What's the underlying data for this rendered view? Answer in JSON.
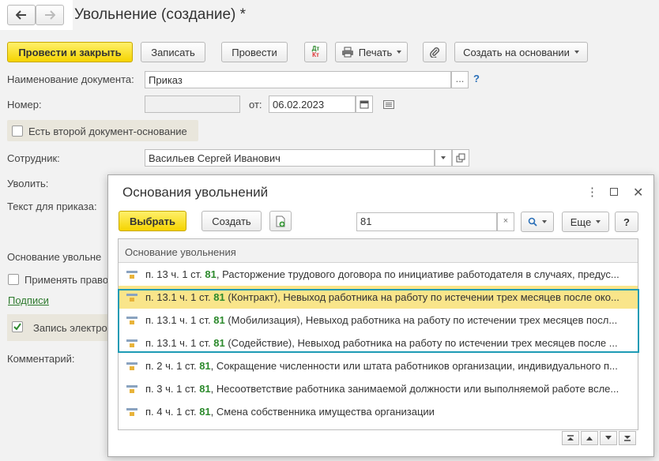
{
  "window": {
    "title": "Увольнение (создание) *"
  },
  "toolbar": {
    "post_close": "Провести и закрыть",
    "save": "Записать",
    "post": "Провести",
    "dtkt_top": "Дт",
    "dtkt_bottom": "Кт",
    "print": "Печать",
    "create_based": "Создать на основании"
  },
  "form": {
    "doc_name_label": "Наименование документа:",
    "doc_name_value": "Приказ",
    "number_label": "Номер:",
    "number_value": "",
    "date_from_label": "от:",
    "date_value": "06.02.2023",
    "second_doc_label": "Есть второй документ-основание",
    "employee_label": "Сотрудник:",
    "employee_value": "Васильев Сергей Иванович",
    "dismiss_label": "Уволить:",
    "order_text_label": "Текст для приказа:",
    "basis_label": "Основание увольне",
    "apply_label": "Применять право",
    "signatures_link": "Подписи",
    "electronic_label": "Запись электро",
    "comment_label": "Комментарий:"
  },
  "dialog": {
    "title": "Основания увольнений",
    "select_button": "Выбрать",
    "create_button": "Создать",
    "search_value": "81",
    "more_button": "Еще",
    "help_button": "?",
    "column_header": "Основание увольнения",
    "rows": [
      {
        "pre": "п. 13 ч. 1 ст. ",
        "num": "81",
        "post": ", Расторжение трудового договора по инициативе работодателя в случаях, предус..."
      },
      {
        "pre": "п. 13.1 ч. 1 ст. ",
        "num": "81",
        "post": " (Контракт), Невыход работника на работу по истечении трех месяцев после око..."
      },
      {
        "pre": "п. 13.1 ч. 1 ст. ",
        "num": "81",
        "post": " (Мобилизация), Невыход работника на работу по истечении трех месяцев посл..."
      },
      {
        "pre": "п. 13.1 ч. 1 ст. ",
        "num": "81",
        "post": " (Содействие), Невыход работника на работу по истечении трех месяцев после ..."
      },
      {
        "pre": "п. 2 ч. 1 ст. ",
        "num": "81",
        "post": ", Сокращение численности или штата работников организации, индивидуального п..."
      },
      {
        "pre": "п. 3 ч. 1 ст. ",
        "num": "81",
        "post": ", Несоответствие работника занимаемой должности или выполняемой работе всле..."
      },
      {
        "pre": "п. 4 ч. 1 ст. ",
        "num": "81",
        "post": ", Смена собственника имущества организации"
      }
    ]
  },
  "colors": {
    "accent_yellow": "#f5d400",
    "selected_row": "#f9e58a",
    "highlight_border": "#1e9bb5",
    "number_green": "#2d8a2d",
    "link_green": "#2d7a2d"
  }
}
